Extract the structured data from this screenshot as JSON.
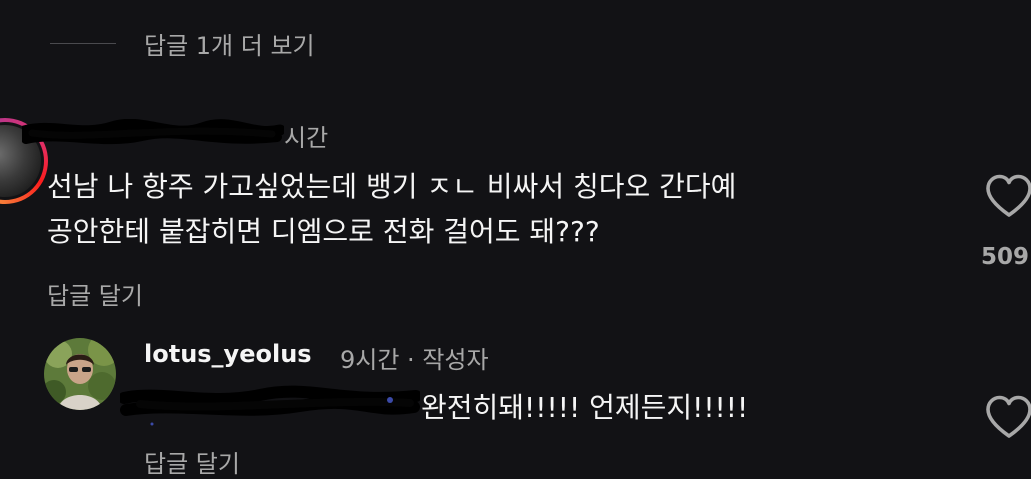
{
  "view_more": {
    "label": "답글 1개 더 보기"
  },
  "comment": {
    "time": "시간",
    "lines": [
      "선남 나 항주 가고싶었는데 뱅기 ㅈㄴ 비싸서 칭다오 간다예",
      "공안한테 붙잡히면 디엠으로 전화 걸어도 돼???"
    ],
    "reply_label": "답글 달기",
    "like_count": "509",
    "like_icon": "heart-outline-icon"
  },
  "reply": {
    "username": "lotus_yeolus",
    "time": "9시간 · 작성자",
    "text": "완전히돼!!!!! 언제든지!!!!!",
    "reply_label": "답글 달기",
    "like_icon": "heart-outline-icon"
  },
  "colors": {
    "background": "#121215",
    "primary_text": "#f5f5f5",
    "secondary_text": "#a8a8a8"
  }
}
